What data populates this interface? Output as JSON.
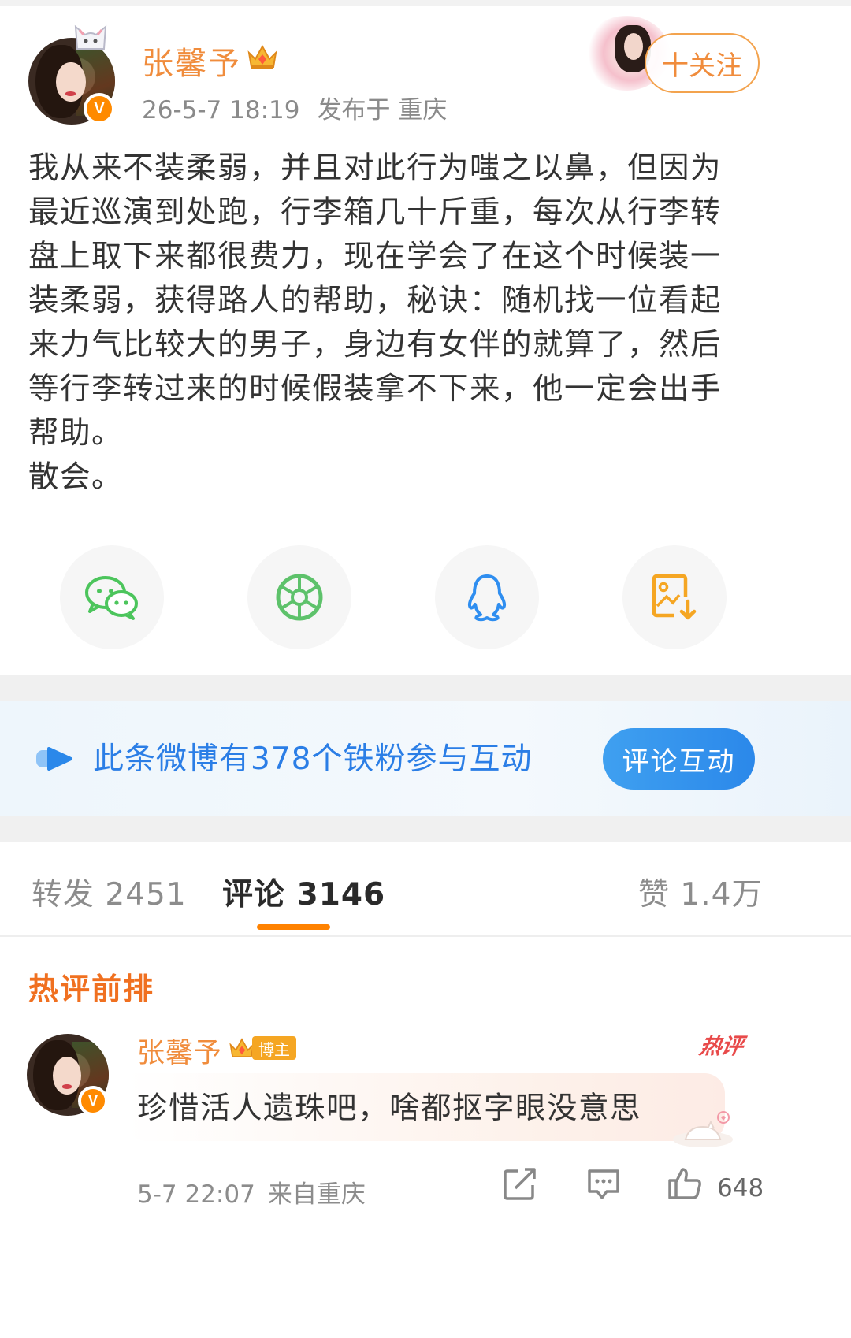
{
  "post": {
    "author": {
      "name": "张馨予",
      "avatar_icon": "avatar-icon",
      "verified_icon": "verified-v-icon",
      "crown_icon": "crown-icon"
    },
    "time": "26-5-7 18:19",
    "location": "发布于 重庆",
    "follow_label": "十关注",
    "text_lines": [
      "我从来不装柔弱，并且对此行为嗤之以鼻，但因为",
      "最近巡演到处跑，行李箱几十斤重，每次从行李转",
      "盘上取下来都很费力，现在学会了在这个时候装一",
      "装柔弱，获得路人的帮助，秘诀：随机找一位看起",
      "来力气比较大的男子，身边有女伴的就算了，然后",
      "等行李转过来的时候假装拿不下来，他一定会出手",
      "帮助。",
      "散会。"
    ]
  },
  "share": {
    "icons": [
      "wechat-icon",
      "moments-icon",
      "qq-icon",
      "save-image-icon"
    ],
    "colors": {
      "wechat": "#4cc55c",
      "moments": "#5ec26b",
      "qq": "#2f8ef0",
      "save": "#f5a623"
    }
  },
  "banner": {
    "text": "此条微博有378个铁粉参与互动",
    "button": "评论互动",
    "color": "#2b7ee6"
  },
  "tabs": {
    "repost": "转发 2451",
    "comments": "评论 3146",
    "likes": "赞 1.4万",
    "active": "comments"
  },
  "hot_section": {
    "title": "热评前排"
  },
  "comment": {
    "author": "张馨予",
    "badge": "博主",
    "hot_stamp": "热评",
    "text": "珍惜活人遗珠吧，啥都抠字眼没意思",
    "time": "5-7 22:07",
    "location": "来自重庆",
    "likes": "648"
  },
  "colors": {
    "accent_orange": "#f08c3c",
    "tab_underline": "#ff8200",
    "hot_title": "#f07020"
  }
}
